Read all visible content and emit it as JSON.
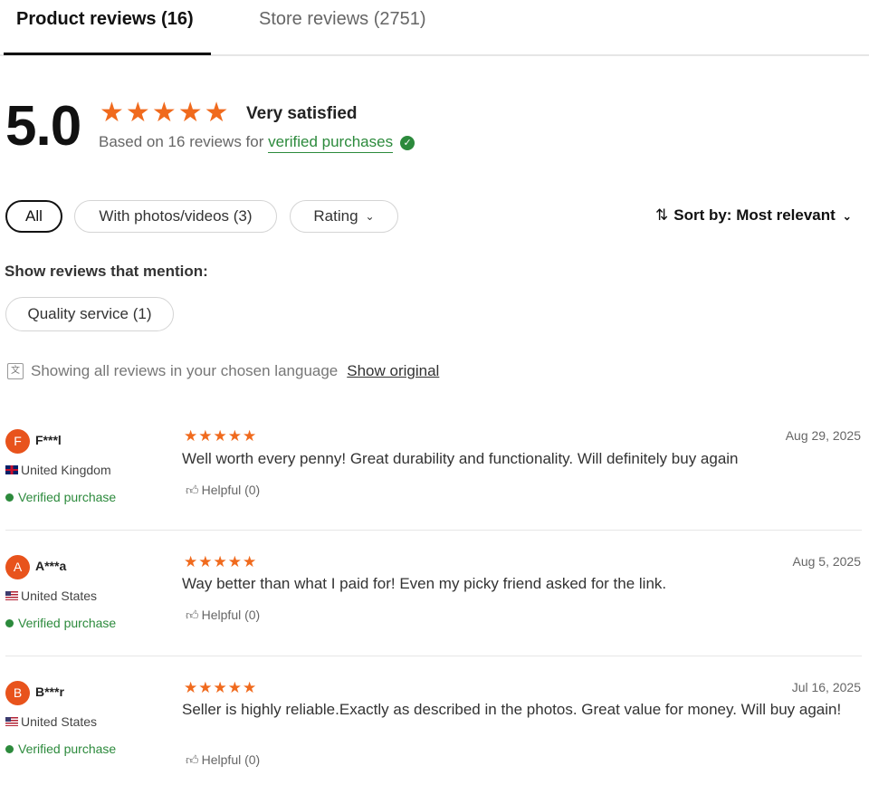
{
  "tabs": {
    "product": "Product reviews (16)",
    "store": "Store reviews (2751)"
  },
  "summary": {
    "score": "5.0",
    "satisfaction": "Very satisfied",
    "based_prefix": "Based on 16 reviews for",
    "verified_link": "verified purchases",
    "star_rating": 5
  },
  "filters": {
    "all": "All",
    "photos": "With photos/videos (3)",
    "rating": "Rating",
    "sort": "Sort by: Most relevant"
  },
  "mentions": {
    "title": "Show reviews that mention:",
    "chips": [
      "Quality service (1)"
    ]
  },
  "language": {
    "text": "Showing all reviews in your chosen language",
    "link": "Show original"
  },
  "reviews": [
    {
      "initial": "F",
      "name": "F***l",
      "country": "United Kingdom",
      "verified": "Verified purchase",
      "date": "Aug 29, 2025",
      "text": "Well worth every penny! Great durability and functionality. Will definitely buy again",
      "helpful": "Helpful (0)",
      "rating": 5
    },
    {
      "initial": "A",
      "name": "A***a",
      "country": "United States",
      "verified": "Verified purchase",
      "date": "Aug 5, 2025",
      "text": "Way better than what I paid for! Even my picky friend asked for the link.",
      "helpful": "Helpful (0)",
      "rating": 5
    },
    {
      "initial": "B",
      "name": "B***r",
      "country": "United States",
      "verified": "Verified purchase",
      "date": "Jul 16, 2025",
      "text": "Seller is highly reliable.Exactly as described in the photos. Great value for money. Will buy again!",
      "helpful": "Helpful (0)",
      "rating": 5
    }
  ],
  "colors": {
    "star": "#f06a1d",
    "verified": "#2c8a3c",
    "avatar": "#e8531c"
  }
}
